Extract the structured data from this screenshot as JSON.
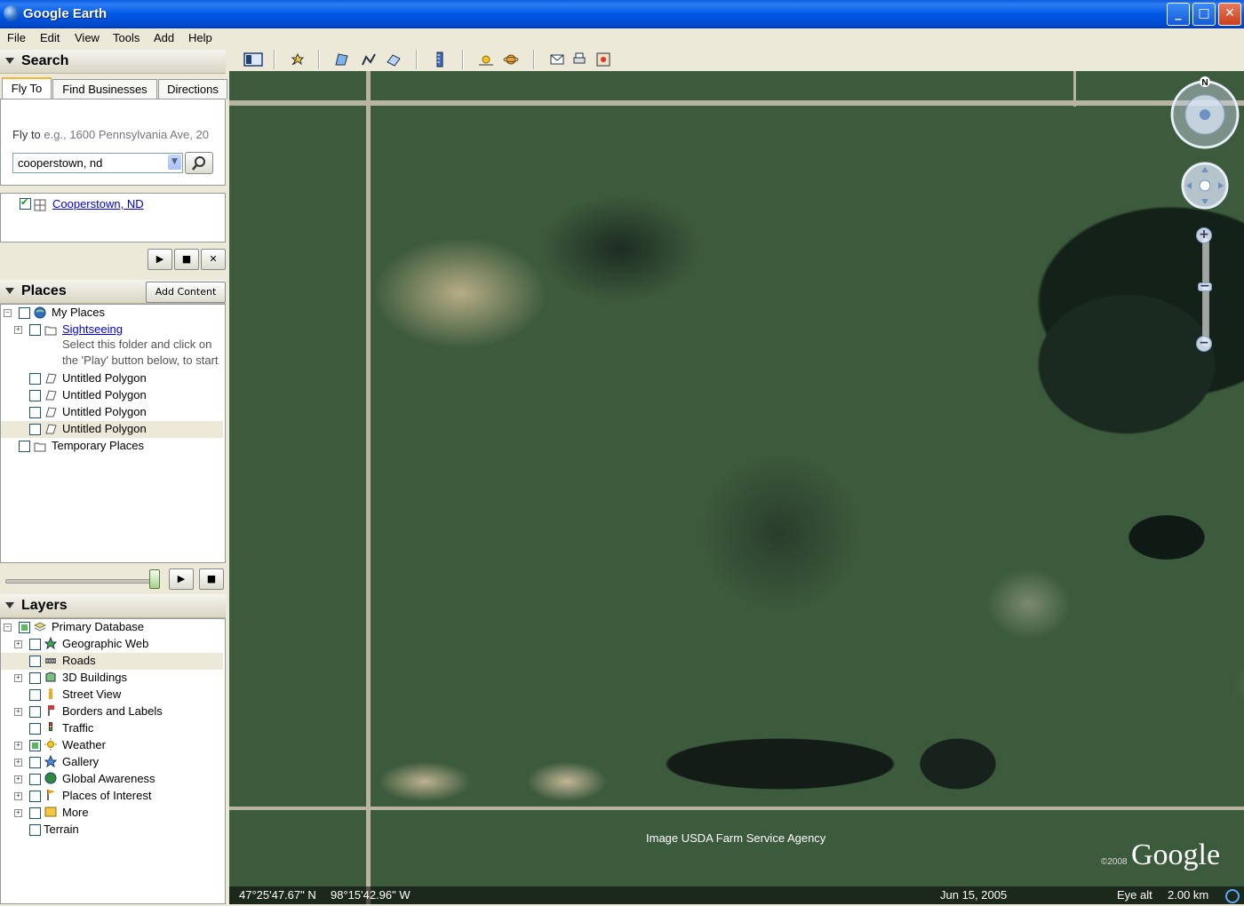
{
  "window": {
    "title": "Google Earth",
    "minimize": "_",
    "maximize": "□",
    "close": "✕"
  },
  "menubar": [
    "File",
    "Edit",
    "View",
    "Tools",
    "Add",
    "Help"
  ],
  "search": {
    "header": "Search",
    "tabs": [
      "Fly To",
      "Find Businesses",
      "Directions"
    ],
    "flyto_label": "Fly to",
    "flyto_placeholder": "e.g., 1600 Pennsylvania Ave, 20",
    "query": "cooperstown, nd",
    "result": "Cooperstown, ND"
  },
  "places": {
    "header": "Places",
    "add_content": "Add Content",
    "items": [
      {
        "label": "My Places",
        "link": false
      },
      {
        "label": "Sightseeing",
        "link": true
      },
      {
        "label": "Select this folder and click on",
        "link": false
      },
      {
        "label": "the 'Play' button below, to start",
        "link": false
      },
      {
        "label": "Untitled Polygon",
        "link": false
      },
      {
        "label": "Untitled Polygon",
        "link": false
      },
      {
        "label": "Untitled Polygon",
        "link": false
      },
      {
        "label": "Untitled Polygon",
        "link": false
      },
      {
        "label": "Temporary Places",
        "link": false
      }
    ]
  },
  "layers": {
    "header": "Layers",
    "items": [
      "Primary Database",
      "Geographic Web",
      "Roads",
      "3D Buildings",
      "Street View",
      "Borders and Labels",
      "Traffic",
      "Weather",
      "Gallery",
      "Global Awareness",
      "Places of Interest",
      "More",
      "Terrain"
    ]
  },
  "map": {
    "compass_n": "N",
    "credit": "Image USDA Farm Service Agency",
    "copyright": "©2008",
    "brand": "Google",
    "lat": "47°25'47.67\" N",
    "lon": "98°15'42.96\" W",
    "date": "Jun 15, 2005",
    "eye_alt_label": "Eye alt",
    "eye_alt_value": "2.00 km"
  }
}
